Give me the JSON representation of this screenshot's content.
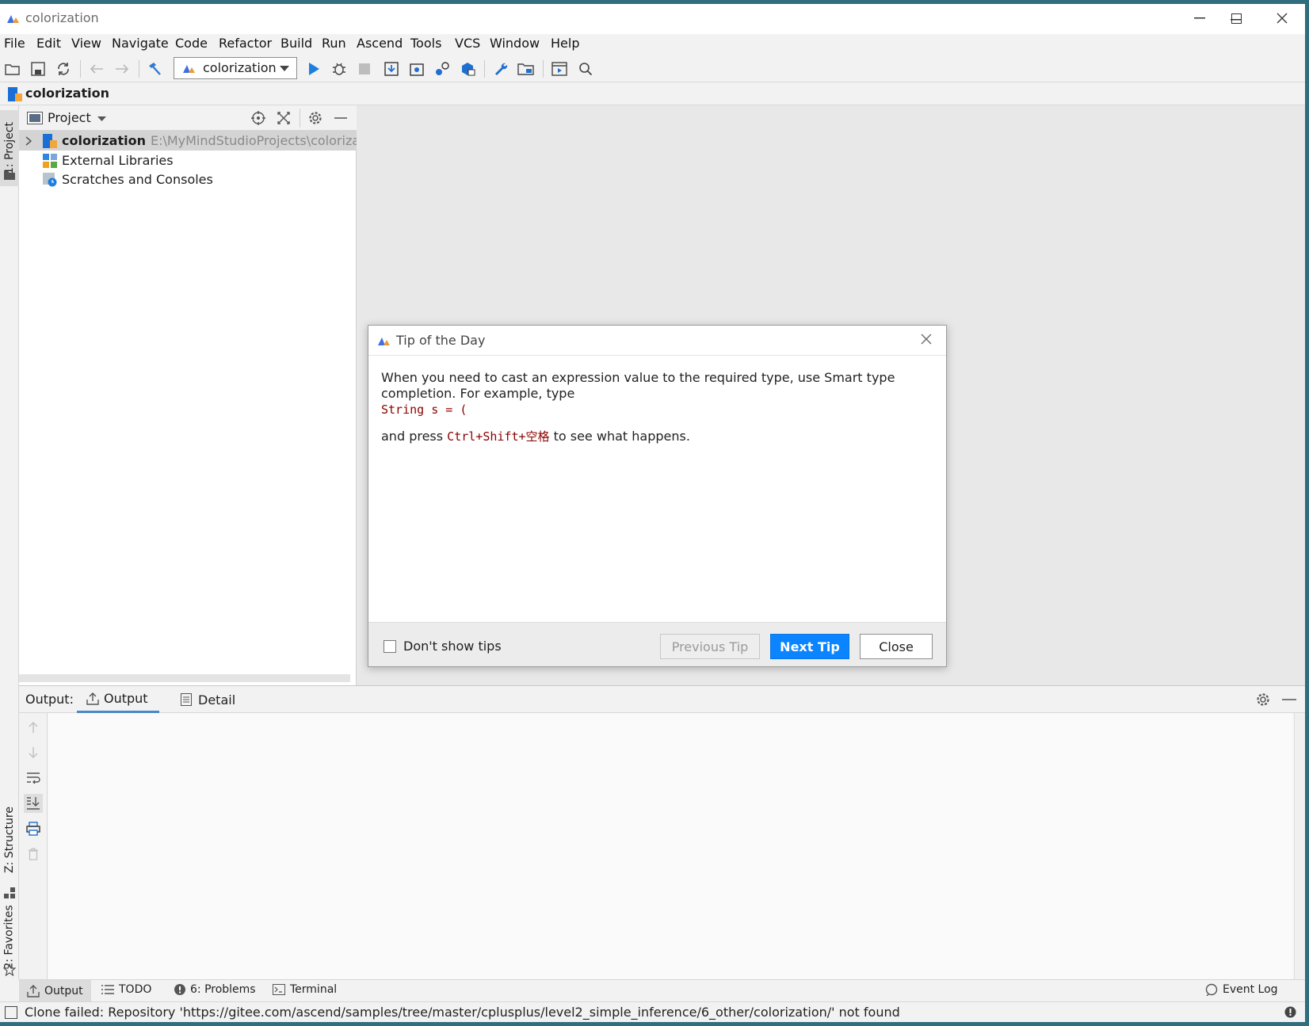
{
  "window": {
    "title": "colorization"
  },
  "menu": [
    "File",
    "Edit",
    "View",
    "Navigate",
    "Code",
    "Refactor",
    "Build",
    "Run",
    "Ascend",
    "Tools",
    "VCS",
    "Window",
    "Help"
  ],
  "toolbar": {
    "run_config": "colorization"
  },
  "navbar": {
    "crumb": "colorization"
  },
  "left_stripe": {
    "project": "1: Project",
    "structure": "Z: Structure",
    "favorites": "2: Favorites"
  },
  "project_panel": {
    "title": "Project",
    "tree": [
      {
        "name": "colorization",
        "path": "E:\\MyMindStudioProjects\\colorization"
      },
      {
        "name": "External Libraries"
      },
      {
        "name": "Scratches and Consoles"
      }
    ]
  },
  "output_panel": {
    "label": "Output:",
    "tabs": [
      "Output",
      "Detail"
    ]
  },
  "bottom_tools": [
    "Output",
    "TODO",
    "6: Problems",
    "Terminal",
    "Event Log"
  ],
  "status": {
    "message": "Clone failed: Repository 'https://gitee.com/ascend/samples/tree/master/cplusplus/level2_simple_inference/6_other/colorization/' not found"
  },
  "dialog": {
    "title": "Tip of the Day",
    "line1": "When you need to cast an expression value to the required type, use Smart type completion. For example, type",
    "code1": "String s = (",
    "line2_pre": "and press ",
    "shortcut": "Ctrl+Shift+空格",
    "line2_post": " to see what happens.",
    "checkbox_label": "Don't show tips",
    "prev_label": "Previous Tip",
    "next_label": "Next Tip",
    "close_label": "Close"
  },
  "colors": {
    "accent": "#0a84ff",
    "frame": "#2f6d7f",
    "code": "#8b0000"
  }
}
